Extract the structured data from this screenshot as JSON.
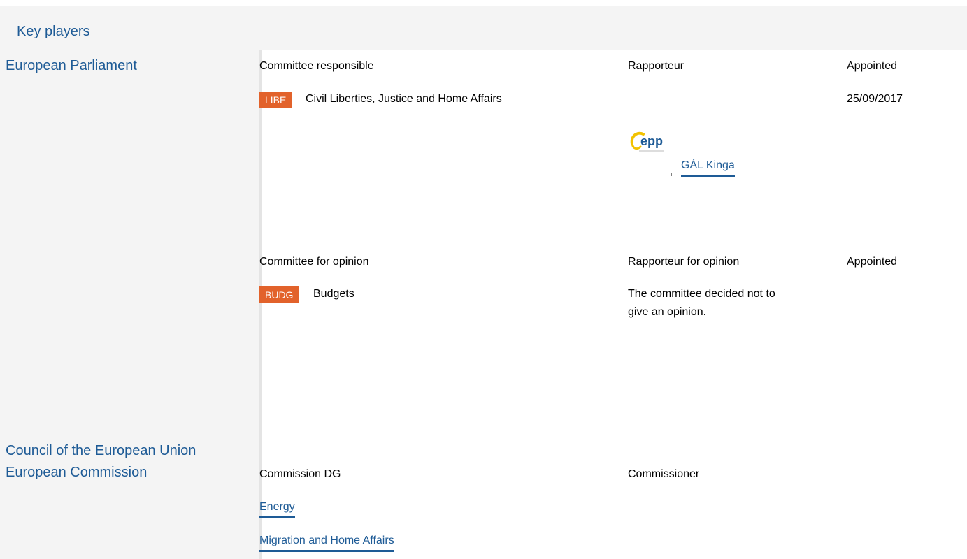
{
  "header": {
    "title": "Key players"
  },
  "institutions": {
    "parliament": "European Parliament",
    "council": "Council of the European Union",
    "commission": "European Commission"
  },
  "parliament": {
    "responsible": {
      "col_committee": "Committee responsible",
      "col_rapporteur": "Rapporteur",
      "col_appointed": "Appointed",
      "badge": "LIBE",
      "committee_name": "Civil Liberties, Justice and Home Affairs",
      "appointed_date": "25/09/2017",
      "rapporteur_name": "GÁL Kinga",
      "group_logo_text": "epp",
      "badge_color": "#e2622b"
    },
    "opinion": {
      "col_committee": "Committee for opinion",
      "col_rapporteur": "Rapporteur for opinion",
      "col_appointed": "Appointed",
      "badge": "BUDG",
      "committee_name": "Budgets",
      "rapporteur_note": "The committee decided not to give an opinion."
    }
  },
  "commission": {
    "col_dg": "Commission DG",
    "col_commissioner": "Commissioner",
    "dgs": [
      "Energy",
      "Migration and Home Affairs"
    ]
  },
  "colors": {
    "link": "#1e5b96",
    "badge": "#e2622b",
    "panel_bg": "#f4f4f4"
  }
}
